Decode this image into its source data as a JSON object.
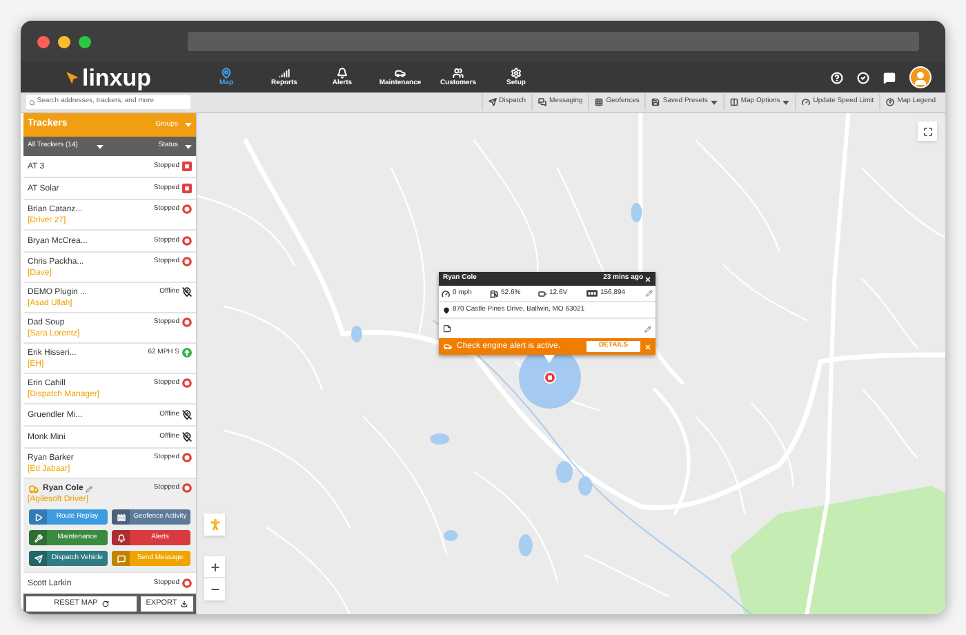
{
  "header": {
    "logo_text": "linxup",
    "nav": [
      {
        "label": "Map",
        "selected": true
      },
      {
        "label": "Reports",
        "selected": false
      },
      {
        "label": "Alerts",
        "selected": false
      },
      {
        "label": "Maintenance",
        "selected": false
      },
      {
        "label": "Customers",
        "selected": false
      },
      {
        "label": "Setup",
        "selected": false
      }
    ]
  },
  "toolbar": {
    "search": {
      "placeholder": "Search addresses, trackers, and more"
    },
    "tools": [
      {
        "label": "Dispatch",
        "dropdown": false
      },
      {
        "label": "Messaging",
        "dropdown": false
      },
      {
        "label": "Geofences",
        "dropdown": false
      },
      {
        "label": "Saved Presets",
        "dropdown": true
      },
      {
        "label": "Map Options",
        "dropdown": true
      },
      {
        "label": "Update Speed Limit",
        "dropdown": false
      },
      {
        "label": "Map Legend",
        "dropdown": false
      }
    ]
  },
  "sidebar": {
    "title": "Trackers",
    "groups_label": "Groups",
    "filter": "All Trackers (14)",
    "status_label": "Status",
    "trackers": [
      {
        "name": "AT 3",
        "status": "Stopped",
        "kind": "square",
        "selected": false
      },
      {
        "name": "AT Solar",
        "status": "Stopped",
        "kind": "square",
        "selected": false
      },
      {
        "name": "Brian Catanz...",
        "driver": "[Driver 27]",
        "status": "Stopped",
        "kind": "ring",
        "selected": false
      },
      {
        "name": "Bryan McCrea...",
        "status": "Stopped",
        "kind": "ring",
        "selected": false
      },
      {
        "name": "Chris Packha...",
        "driver": "[Dave]",
        "status": "Stopped",
        "kind": "ring",
        "selected": false
      },
      {
        "name": "DEMO Plugin ...",
        "driver": "[Asad Ullah]",
        "status": "Offline",
        "kind": "offline",
        "selected": false
      },
      {
        "name": "Dad Soup",
        "driver": "[Sara Lorentz]",
        "status": "Stopped",
        "kind": "ring",
        "selected": false
      },
      {
        "name": "Erik Hisseri...",
        "driver": "[EH]",
        "status": "62 MPH S",
        "kind": "moving",
        "selected": false
      },
      {
        "name": "Erin Cahill",
        "driver": "[Dispatch Manager]",
        "status": "Stopped",
        "kind": "ring",
        "selected": false
      },
      {
        "name": "Gruendler Mi...",
        "status": "Offline",
        "kind": "offline",
        "selected": false
      },
      {
        "name": "Monk Mini",
        "status": "Offline",
        "kind": "offline",
        "selected": false
      },
      {
        "name": "Ryan Barker",
        "driver": "[Ed Jabaar]",
        "status": "Stopped",
        "kind": "ring",
        "selected": false
      },
      {
        "name": "Ryan Cole",
        "driver": "[Agilesoft Driver]",
        "status": "Stopped",
        "kind": "ring",
        "selected": true,
        "actions": [
          {
            "label": "Route Replay",
            "color": "#3d9be0"
          },
          {
            "label": "Geofence Activity",
            "color": "#5d7a98"
          },
          {
            "label": "Maintenance",
            "color": "#3a8a40"
          },
          {
            "label": "Alerts",
            "color": "#d83a40"
          },
          {
            "label": "Dispatch Vehicle",
            "color": "#2e7d83"
          },
          {
            "label": "Send Message",
            "color": "#f0a400"
          }
        ]
      },
      {
        "name": "Scott Larkin",
        "status": "Stopped",
        "kind": "ring",
        "selected": false
      }
    ],
    "footer_buttons": [
      "RESET MAP",
      "EXPORT"
    ]
  },
  "map": {
    "popup": {
      "title": "Ryan Cole",
      "time": "23 mins ago",
      "stats": [
        "0 mph",
        "52.6%",
        "12.6V",
        "156,894"
      ],
      "address": "870 Castle Pines Drive, Ballwin, MO 63021",
      "alert": "Check engine alert is active.",
      "alert_button": "DETAILS"
    }
  }
}
